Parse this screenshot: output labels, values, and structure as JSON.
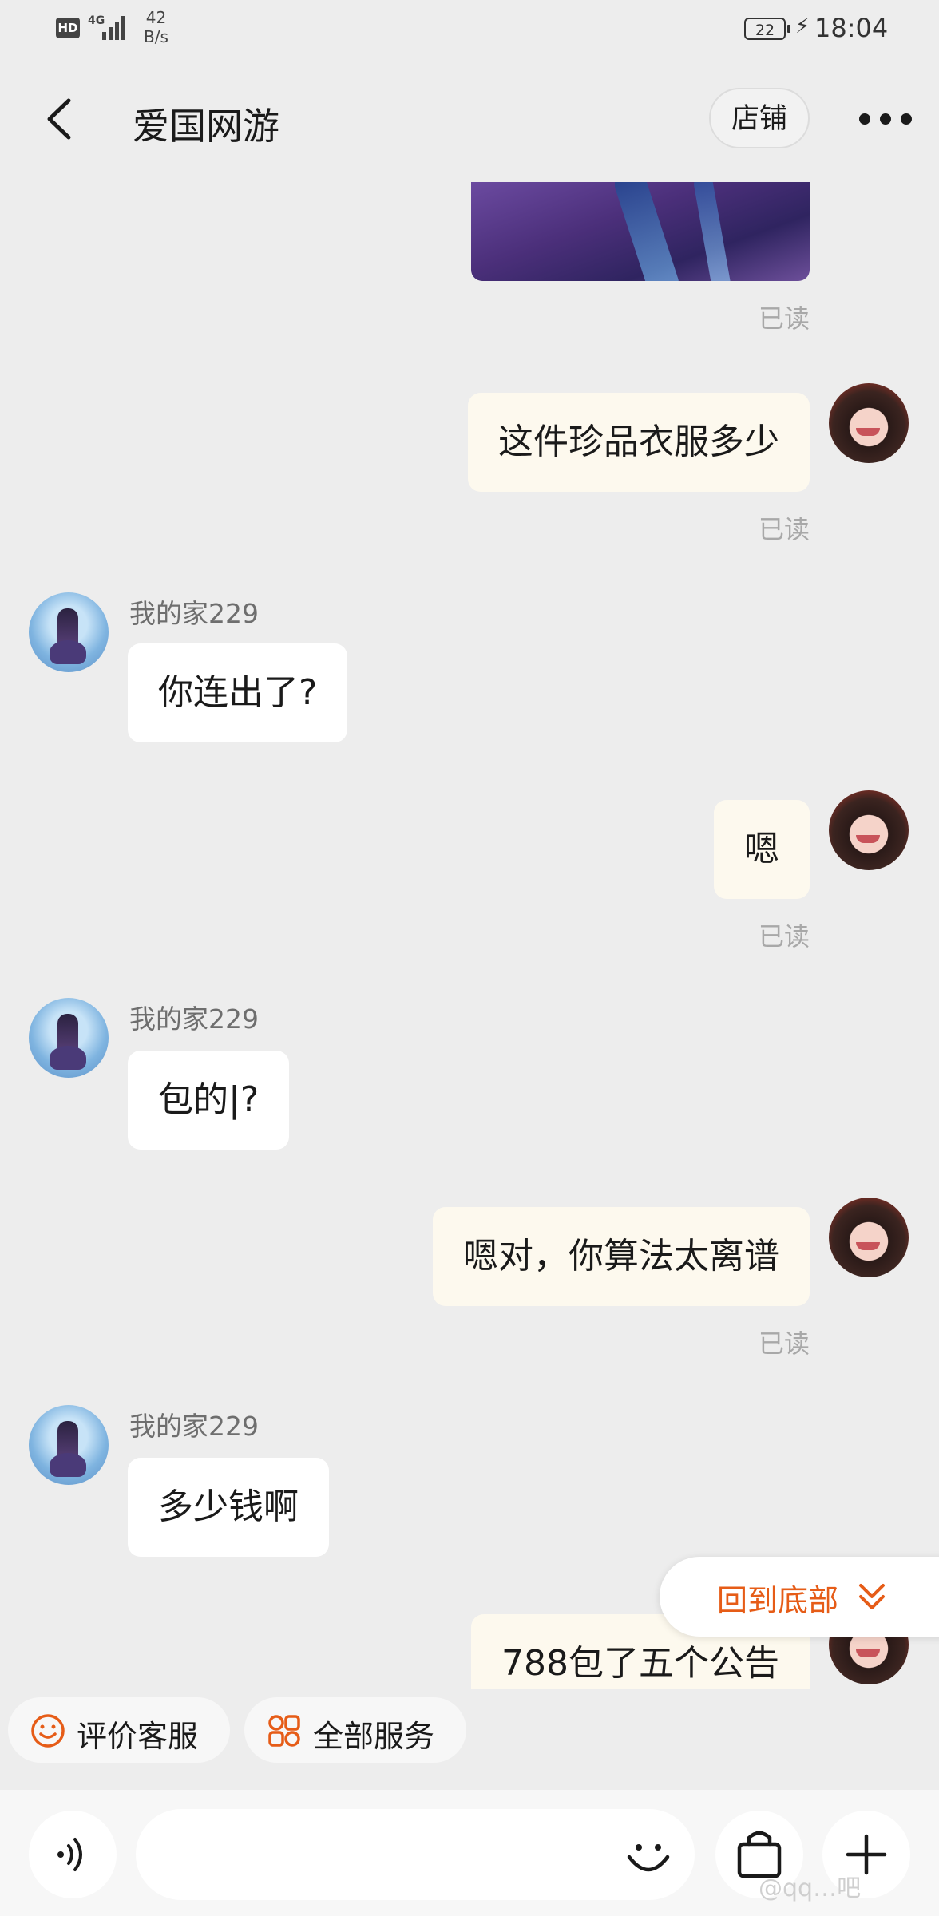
{
  "status_bar": {
    "hd": "HD",
    "network": "4G",
    "speed_value": "42",
    "speed_unit": "B/s",
    "battery": "22",
    "time": "18:04"
  },
  "nav": {
    "title": "爱国网游",
    "shop_button": "店铺"
  },
  "messages": [
    {
      "side": "right",
      "type": "image",
      "read": "已读"
    },
    {
      "side": "right",
      "type": "text",
      "text": "这件珍品衣服多少",
      "read": "已读"
    },
    {
      "side": "left",
      "sender": "我的家229",
      "text": "你连出了?"
    },
    {
      "side": "right",
      "type": "text",
      "text": "嗯",
      "read": "已读"
    },
    {
      "side": "left",
      "sender": "我的家229",
      "text": "包的|?"
    },
    {
      "side": "right",
      "type": "text",
      "text": "嗯对，你算法太离谱",
      "read": "已读"
    },
    {
      "side": "left",
      "sender": "我的家229",
      "text": "多少钱啊"
    },
    {
      "side": "right",
      "type": "text",
      "text": "788包了五个公告"
    }
  ],
  "back_to_bottom": "回到底部",
  "quick_actions": [
    {
      "label": "评价客服",
      "icon": "smiley-icon"
    },
    {
      "label": "全部服务",
      "icon": "grid-services-icon"
    }
  ],
  "input_bar": {
    "voice_icon": "voice-icon",
    "emoji_icon": "emoji-icon",
    "bag_icon": "shopping-bag-icon",
    "plus_icon": "plus-icon"
  },
  "watermark": "@qq…吧",
  "colors": {
    "accent_orange": "#e65c17",
    "background": "#ededed",
    "my_bubble": "#fdf9ee",
    "their_bubble": "#ffffff"
  }
}
